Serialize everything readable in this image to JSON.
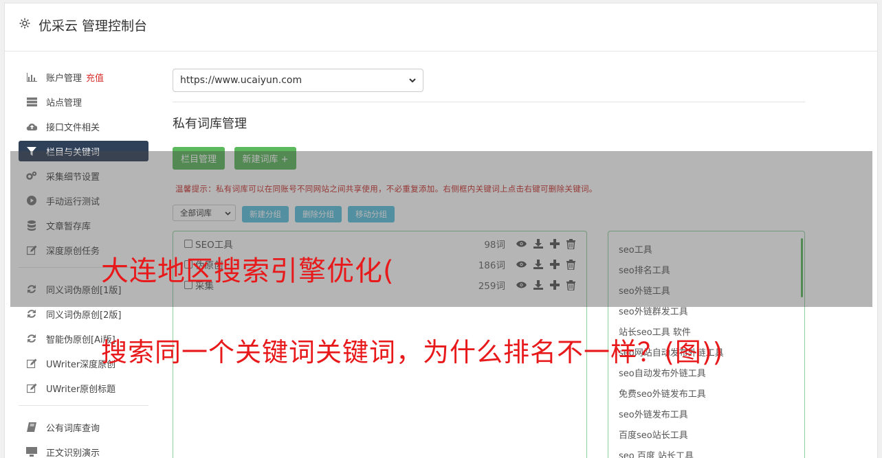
{
  "header": {
    "title": "优采云 管理控制台",
    "icon": "gear-icon"
  },
  "sidebar": {
    "items": [
      {
        "label": "账户管理",
        "extra": "充值",
        "icon": "bar-chart-icon"
      },
      {
        "label": "站点管理",
        "icon": "server-icon"
      },
      {
        "label": "接口文件相关",
        "icon": "cloud-upload-icon"
      },
      {
        "label": "栏目与关键词",
        "icon": "filter-icon",
        "active": true
      },
      {
        "label": "采集细节设置",
        "icon": "cogs-icon"
      },
      {
        "label": "手动运行测试",
        "icon": "play-circle-icon"
      },
      {
        "label": "文章暂存库",
        "icon": "database-icon"
      },
      {
        "label": "深度原创任务",
        "icon": "edit-icon"
      }
    ],
    "items2": [
      {
        "label": "同义词伪原创[1版]",
        "icon": "refresh-icon"
      },
      {
        "label": "同义词伪原创[2版]",
        "icon": "refresh-icon"
      },
      {
        "label": "智能伪原创[Ai版]",
        "icon": "refresh-icon"
      },
      {
        "label": "UWriter深度原创",
        "icon": "edit-icon"
      },
      {
        "label": "UWriter原创标题",
        "icon": "edit-icon"
      }
    ],
    "items3": [
      {
        "label": "公有词库查询",
        "icon": "book-icon"
      },
      {
        "label": "正文识别演示",
        "icon": "desktop-icon"
      }
    ]
  },
  "main": {
    "site_select": "https://www.ucaiyun.com",
    "section_title": "私有词库管理",
    "btn_column": "栏目管理",
    "btn_new_lib": "新建词库 +",
    "tip": "温馨提示：私有词库可以在同账号不同网站之间共享使用，不必重复添加。右侧框内关键词上点击右键可删除关键词。",
    "filter_select": "全部词库",
    "btn_new_group": "新建分组",
    "btn_delete_group": "删除分组",
    "btn_move_group": "移动分组",
    "groups": [
      {
        "name": "SEO工具",
        "count": "98词"
      },
      {
        "name": "伪原创",
        "count": "186词"
      },
      {
        "name": "采集",
        "count": "259词"
      }
    ],
    "keywords": [
      "seo工具",
      "seo排名工具",
      "seo外链工具",
      "seo外链群发工具",
      "站长seo工具 软件",
      "seo网站自动发布外链工具",
      "seo自动发布外链工具",
      "免费seo外链发布工具",
      "seo外链发布工具",
      "百度seo站长工具",
      "seo 百度 站长工具"
    ]
  },
  "overlay": {
    "line1": "大连地区搜索引擎优化(",
    "line2": "搜索同一个关键词关键词，为什么排名不一样？(图))"
  },
  "colors": {
    "accent_green": "#5cb85c",
    "accent_blue": "#5bc0de",
    "active_nav": "#2f4059",
    "overlay_text": "#e8191b"
  }
}
